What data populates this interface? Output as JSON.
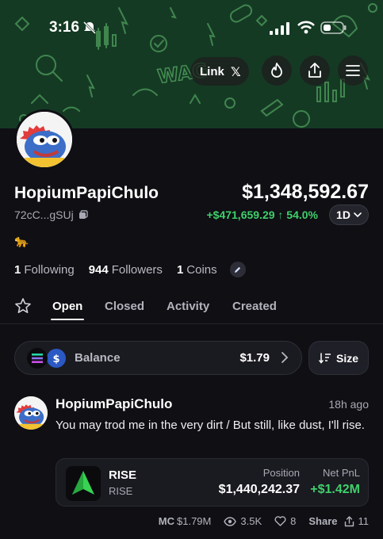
{
  "status_bar": {
    "time": "3:16"
  },
  "banner": {
    "link_label": "Link",
    "x_glyph": "𝕏",
    "watermark": "WAG"
  },
  "profile": {
    "name": "HopiumPapiChulo",
    "portfolio_value": "$1,348,592.67",
    "address": "72cC...gSUj",
    "pnl": "+$471,659.29 ↑ 54.0%",
    "period": "1D",
    "emoji": "🐆",
    "following_count": "1",
    "following_label": "Following",
    "followers_count": "944",
    "followers_label": "Followers",
    "coins_count": "1",
    "coins_label": "Coins"
  },
  "tabs": [
    {
      "label": "Open",
      "active": true
    },
    {
      "label": "Closed",
      "active": false
    },
    {
      "label": "Activity",
      "active": false
    },
    {
      "label": "Created",
      "active": false
    }
  ],
  "balance": {
    "label": "Balance",
    "value": "$1.79",
    "size_label": "Size"
  },
  "post": {
    "author": "HopiumPapiChulo",
    "time": "18h ago",
    "text": "You may trod me in the very dirt / But still, like dust, I'll rise.",
    "coin": {
      "name": "RISE",
      "symbol": "RISE",
      "position_label": "Position",
      "position_value": "$1,440,242.37",
      "pnl_label": "Net PnL",
      "pnl_value": "+$1.42M"
    },
    "footer": {
      "mc_label": "MC",
      "mc_value": "$1.79M",
      "views": "3.5K",
      "likes": "8",
      "share_label": "Share",
      "shares": "11"
    }
  },
  "colors": {
    "accent_green": "#3fd06b",
    "background": "#0f0f14",
    "banner_green": "#153a24"
  }
}
